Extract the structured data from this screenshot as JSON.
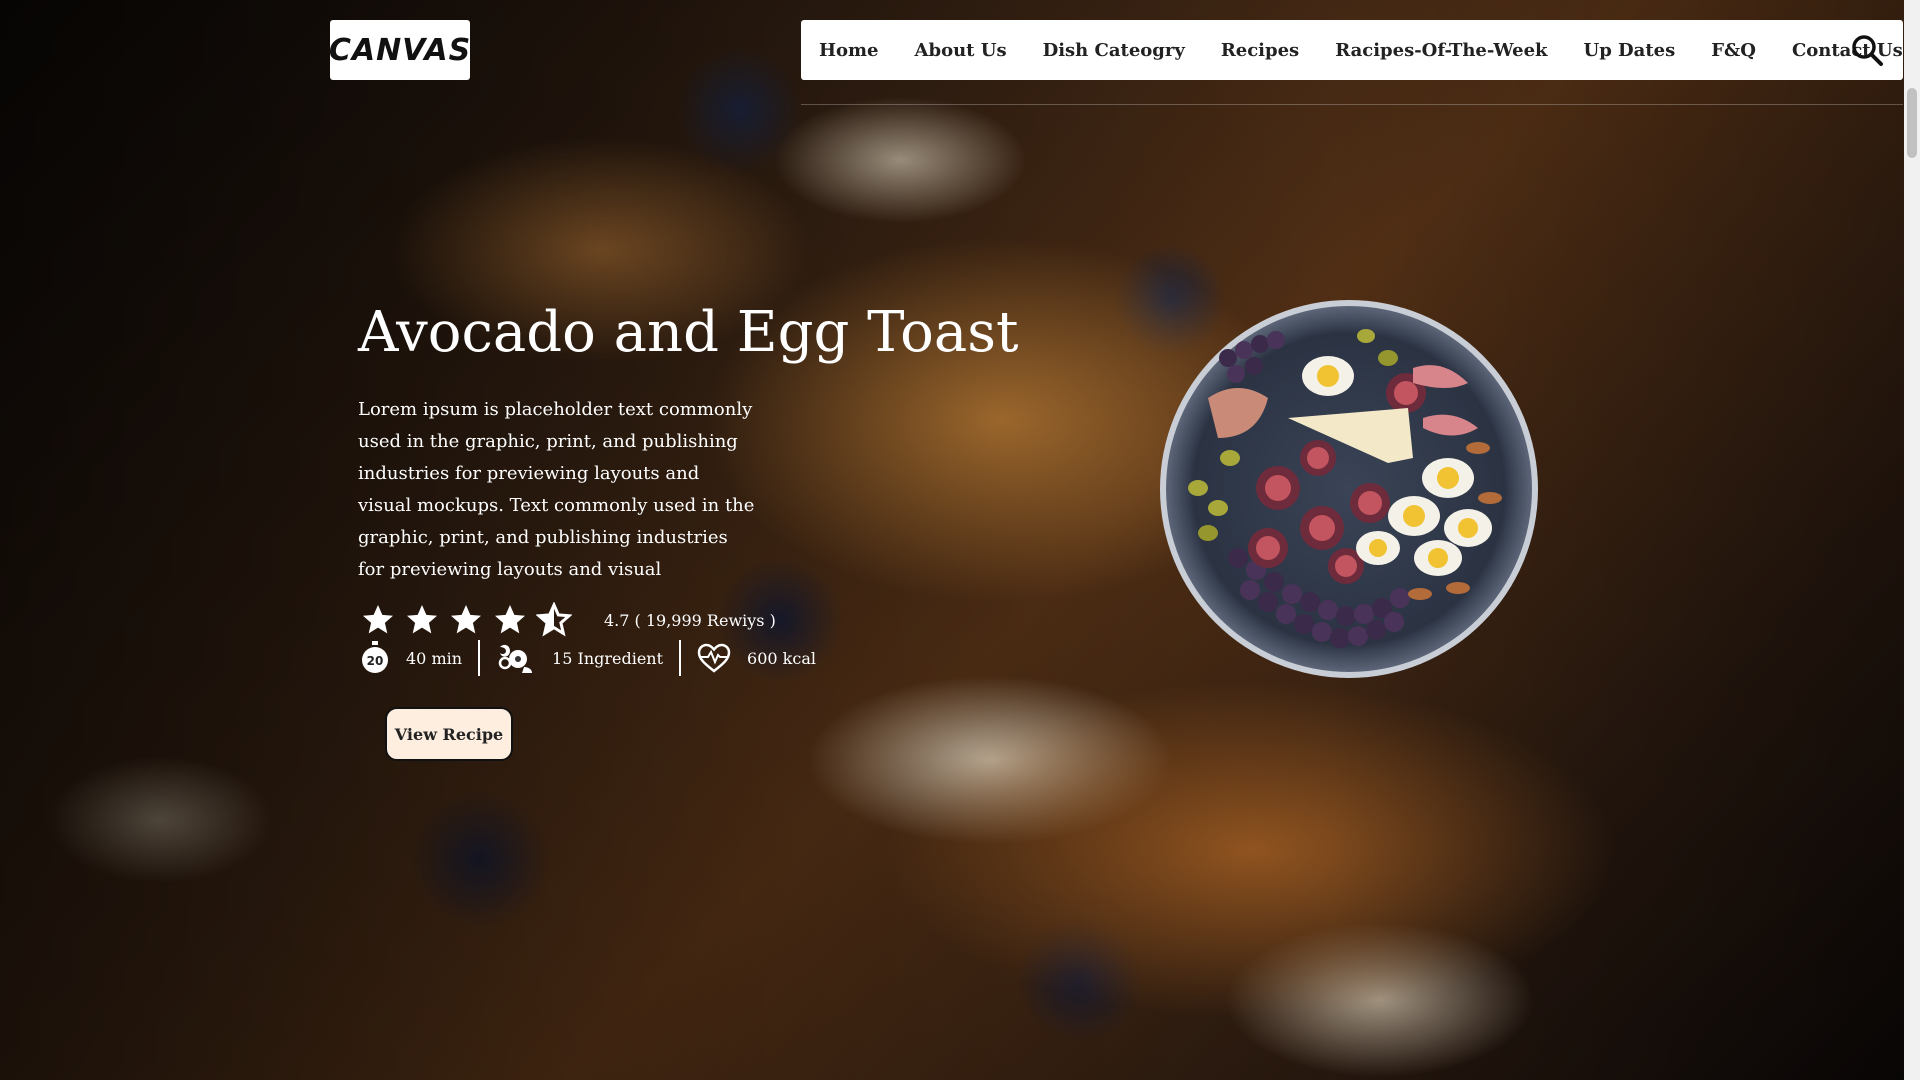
{
  "brand": {
    "logo_text": "CANVAS"
  },
  "nav": {
    "items": [
      {
        "label": "Home"
      },
      {
        "label": "About Us"
      },
      {
        "label": "Dish Cateogry"
      },
      {
        "label": "Recipes"
      },
      {
        "label": "Racipes-Of-The-Week"
      },
      {
        "label": "Up Dates"
      },
      {
        "label": "F&Q"
      },
      {
        "label": "Contact Us"
      }
    ],
    "search_icon": "search-icon"
  },
  "hero": {
    "title": "Avocado and Egg Toast",
    "description": "Lorem ipsum is placeholder text commonly used in the graphic, print, and publishing industries for previewing layouts and visual mockups. Text commonly used in the graphic, print, and publishing industries for previewing layouts and visual",
    "rating": {
      "stars": 4.5,
      "max": 5,
      "text": "4.7 ( 19,999 Rewiys )"
    },
    "meta": {
      "time_icon_text": "20",
      "time": "40 min",
      "ingredients": "15 Ingredient",
      "calories": "600 kcal"
    },
    "cta_label": "View Recipe"
  },
  "colors": {
    "cta_bg": "#fdeee0",
    "text_light": "#ffffff",
    "nav_bg": "#ffffff"
  }
}
